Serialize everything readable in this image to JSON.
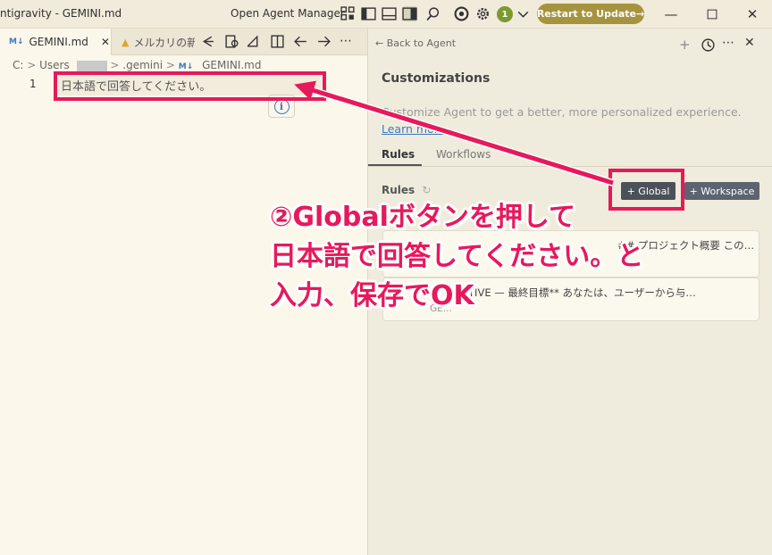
{
  "titlebar": {
    "app_title": "ntigravity - GEMINI.md",
    "agent_manager_label": "Open Agent Manager",
    "badge_count": "1",
    "restart_label": "Restart to Update→"
  },
  "editor": {
    "tabs": [
      {
        "icon": "M↓",
        "label": "GEMINI.md"
      },
      {
        "icon": "triangle-icon",
        "label": "メルカリの新"
      }
    ],
    "breadcrumb": {
      "drive": "C:",
      "user_dir": "Users",
      "hidden_dir": "",
      "gemini_dir": ".gemini",
      "file_icon": "M↓",
      "file": "GEMINI.md"
    },
    "line_number": "1",
    "line_text": "日本語で回答してください。"
  },
  "panel": {
    "back_label": "Back to Agent",
    "title": "Customizations",
    "description": "Customize Agent to get a better, more personalized experience.",
    "learn_more": "Learn more",
    "tabs": [
      "Rules",
      "Workflows"
    ],
    "rules_label": "Rules",
    "global_button": "+ Global",
    "workspace_button": "+ Workspace",
    "cards": [
      {
        "text": "## プロジェクト概要 この…",
        "sub": ""
      },
      {
        "text": "CTIVE — 最終目標** あなたは、ユーザーから与…",
        "sub": "GE..."
      }
    ]
  },
  "annotation": {
    "lines": [
      "②Globalボタンを押して",
      "日本語で回答してください。と",
      "入力、保存でOK"
    ]
  },
  "colors": {
    "annotation_red": "#e6195b",
    "restart_button": "#a6933e",
    "global_button": "#4b5159"
  }
}
